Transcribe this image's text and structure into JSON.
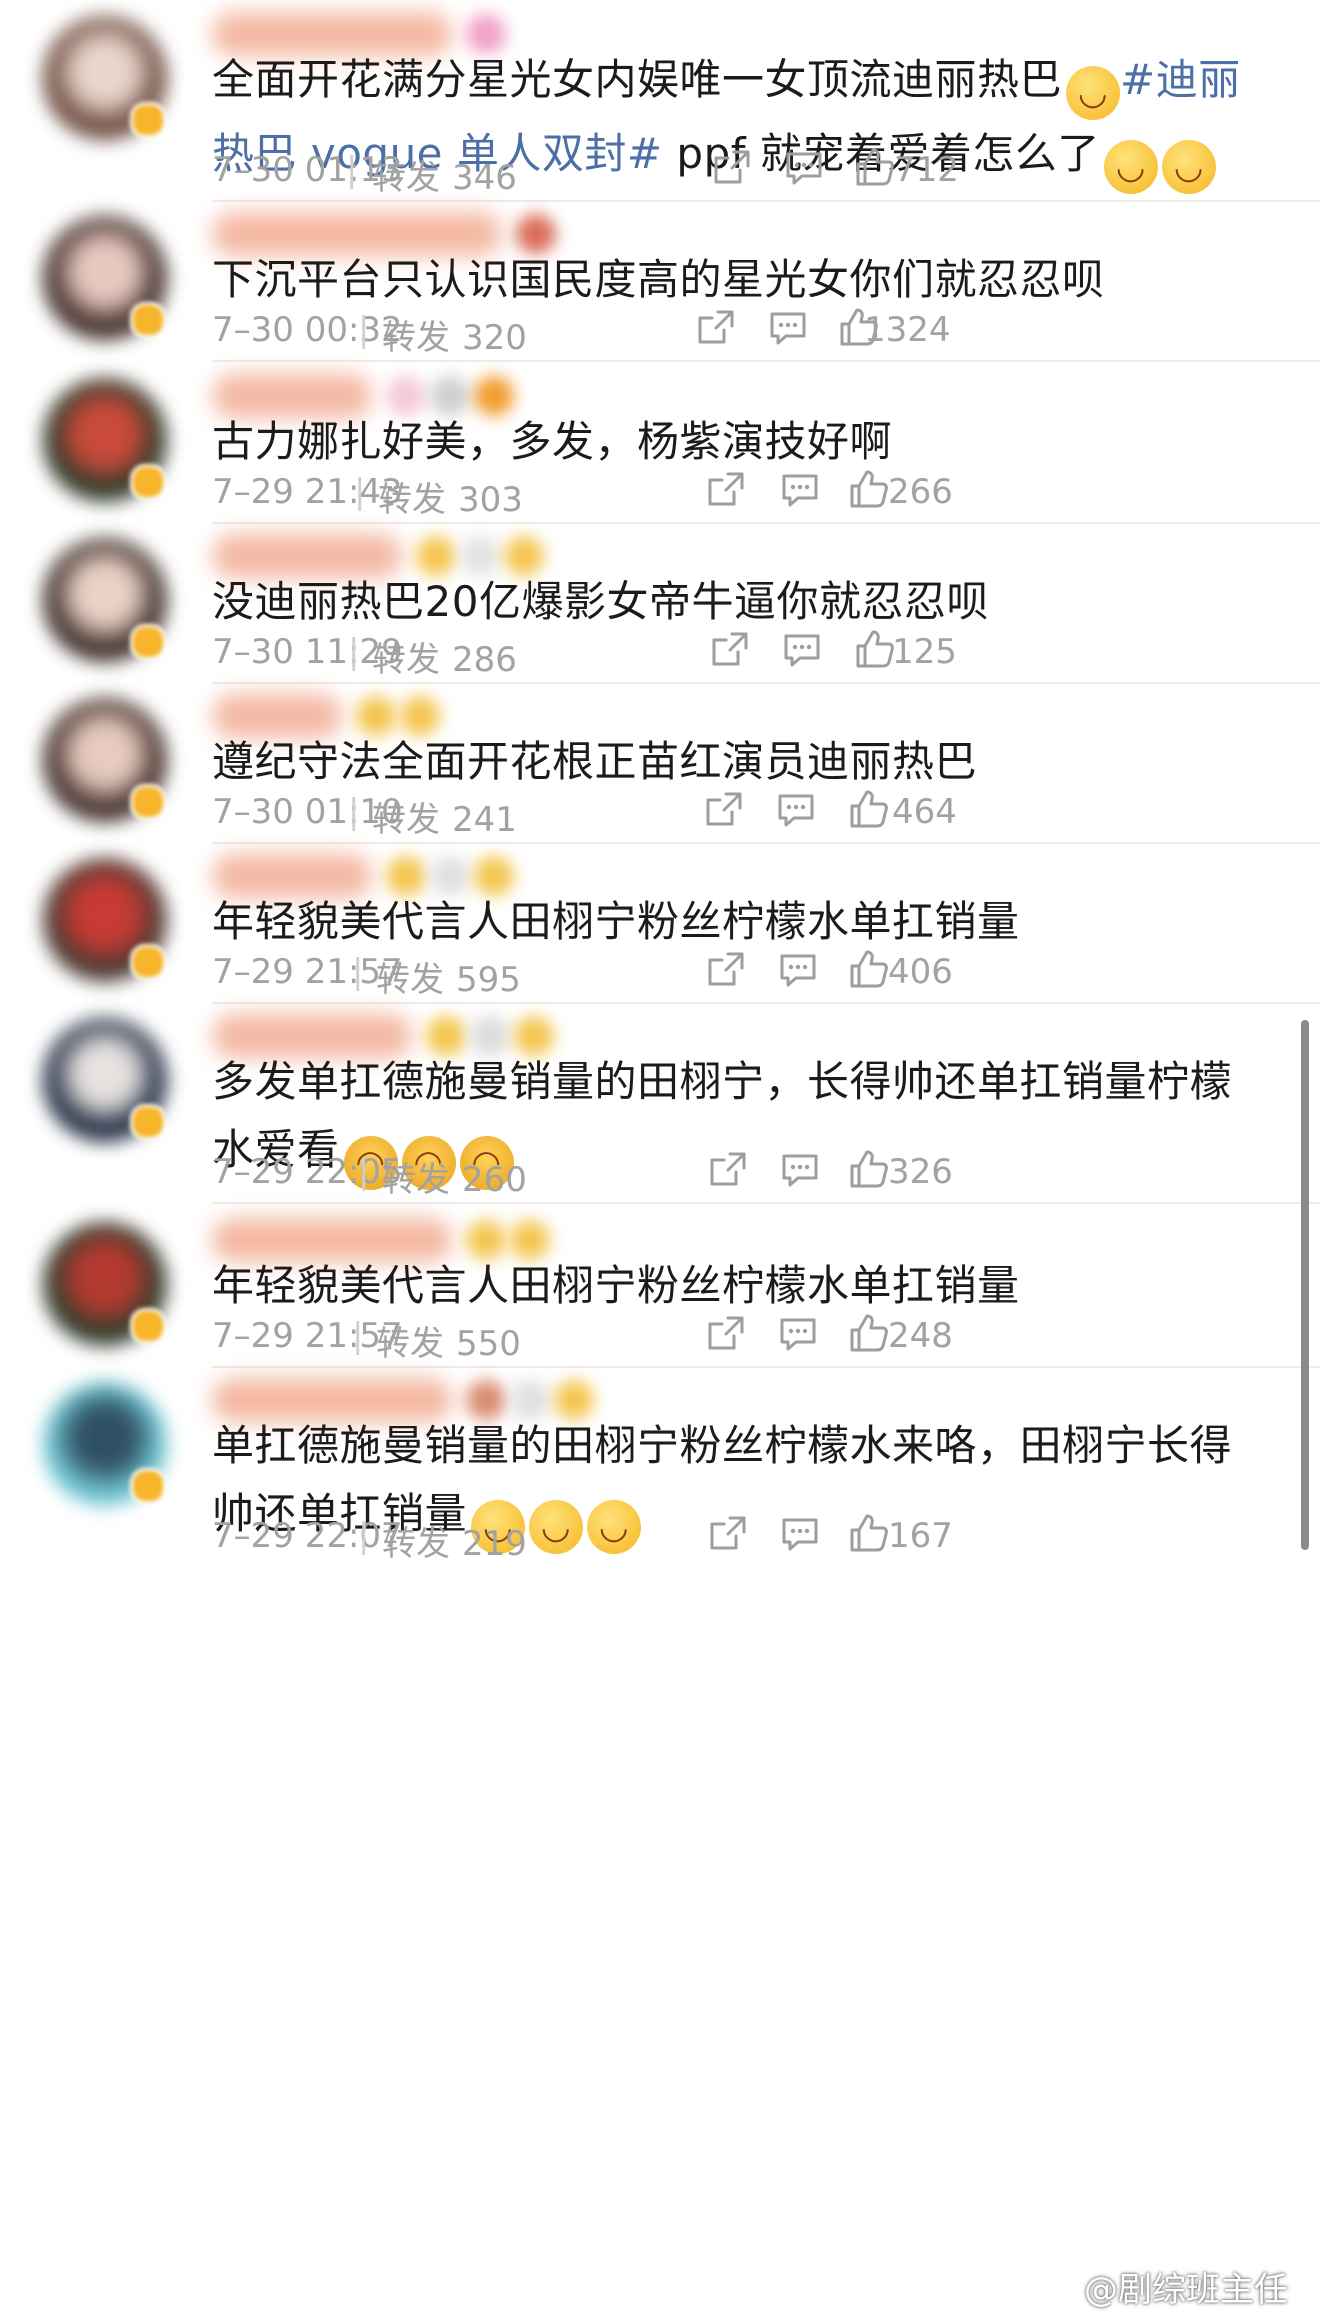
{
  "feed": {
    "posts": [
      {
        "content": "全面开花满分星光女内娱唯一女顶流迪丽热巴",
        "emoji_after_content": "face",
        "hashtag": "#迪丽热巴 vogue 单人双封#",
        "tail": " ppf 就宠着爱着怎么了",
        "tail_emoji": [
          "face",
          "face"
        ],
        "time": "7–30 01:13",
        "repost_label": "转发",
        "repost_count": "346",
        "like_count": "712"
      },
      {
        "content": "下沉平台只认识国民度高的星光女你们就忍忍呗",
        "time": "7–30 00:32",
        "repost_label": "转发",
        "repost_count": "320",
        "like_count": "1324"
      },
      {
        "content": "古力娜扎好美，多发，杨紫演技好啊",
        "time": "7–29 21:43",
        "repost_label": "转发",
        "repost_count": "303",
        "like_count": "266"
      },
      {
        "content": "没迪丽热巴20亿爆影女帝牛逼你就忍忍呗",
        "time": "7–30 11:29",
        "repost_label": "转发",
        "repost_count": "286",
        "like_count": "125"
      },
      {
        "content": "遵纪守法全面开花根正苗红演员迪丽热巴",
        "time": "7–30 01:10",
        "repost_label": "转发",
        "repost_count": "241",
        "like_count": "464"
      },
      {
        "content": "年轻貌美代言人田栩宁粉丝柠檬水单扛销量",
        "time": "7–29 21:57",
        "repost_label": "转发",
        "repost_count": "595",
        "like_count": "406"
      },
      {
        "content": "多发单扛德施曼销量的田栩宁，长得帅还单扛销量柠檬水爱看",
        "tail_emoji": [
          "hug",
          "hug",
          "hug"
        ],
        "time": "7–29 22:05",
        "repost_label": "转发",
        "repost_count": "260",
        "like_count": "326"
      },
      {
        "content": "年轻貌美代言人田栩宁粉丝柠檬水单扛销量",
        "time": "7–29 21:57",
        "repost_label": "转发",
        "repost_count": "550",
        "like_count": "248"
      },
      {
        "content": "单扛德施曼销量的田栩宁粉丝柠檬水来咯，田栩宁长得帅还单扛销量",
        "tail_emoji": [
          "face",
          "face",
          "face"
        ],
        "time": "7–29 22:07",
        "repost_label": "转发",
        "repost_count": "219",
        "like_count": "167"
      }
    ]
  },
  "watermark": {
    "text": "@剧综班主任"
  },
  "colors": {
    "text": "#1b1b1b",
    "meta": "#a2a2a2",
    "hashtag": "#4b6fa6",
    "divider": "#ececec"
  },
  "icons": {
    "share": "share-icon",
    "comment": "comment-icon",
    "like": "like-icon",
    "verified": "verified-badge-icon"
  }
}
